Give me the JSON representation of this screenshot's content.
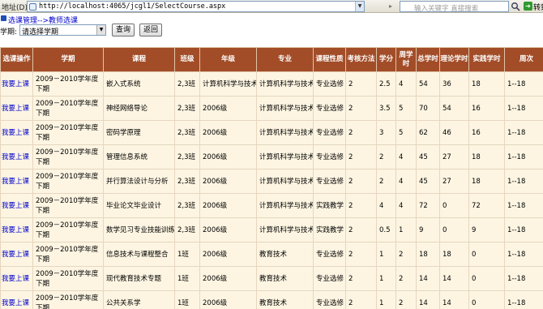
{
  "browser": {
    "address_label": "地址(D)",
    "url": "http://localhost:4065/jcgl1/SelectCourse.aspx",
    "search_placeholder": "输入关键字 直接搜索",
    "go_label": "转到"
  },
  "breadcrumb": "选课管理-->教师选课",
  "filter": {
    "label": "学期:",
    "select_value": "请选择学期",
    "query_button": "查询",
    "back_button": "返回"
  },
  "table": {
    "headers": [
      "选课操作",
      "学期",
      "课程",
      "班级",
      "年级",
      "专业",
      "课程性质",
      "考核方法",
      "学分",
      "周学时",
      "总学时",
      "理论学时",
      "实践学时",
      "周次"
    ],
    "rows": [
      [
        "我要上课",
        "2009－2010学年度下期",
        "嵌入式系统",
        "2,3班",
        "计算机科学与技术",
        "计算机科学与技术",
        "专业选修",
        "2",
        "2.5",
        "4",
        "54",
        "36",
        "18",
        "1--18"
      ],
      [
        "我要上课",
        "2009－2010学年度下期",
        "神经网络导论",
        "2,3班",
        "2006级",
        "计算机科学与技术",
        "专业选修",
        "2",
        "3.5",
        "5",
        "70",
        "54",
        "16",
        "1--18"
      ],
      [
        "我要上课",
        "2009－2010学年度下期",
        "密码学原理",
        "2,3班",
        "2006级",
        "计算机科学与技术",
        "专业选修",
        "2",
        "3",
        "5",
        "62",
        "46",
        "16",
        "1--18"
      ],
      [
        "我要上课",
        "2009－2010学年度下期",
        "管理信息系统",
        "2,3班",
        "2006级",
        "计算机科学与技术",
        "专业选修",
        "2",
        "2",
        "4",
        "45",
        "27",
        "18",
        "1--18"
      ],
      [
        "我要上课",
        "2009－2010学年度下期",
        "并行算法设计与分析",
        "2,3班",
        "2006级",
        "计算机科学与技术",
        "专业选修",
        "2",
        "2",
        "4",
        "45",
        "27",
        "18",
        "1--18"
      ],
      [
        "我要上课",
        "2009－2010学年度下期",
        "毕业论文毕业设计",
        "2,3班",
        "2006级",
        "计算机科学与技术",
        "实践教学",
        "2",
        "4",
        "4",
        "72",
        "0",
        "72",
        "1--18"
      ],
      [
        "我要上课",
        "2009－2010学年度下期",
        "数学见习专业技能训练",
        "2,3班",
        "2006级",
        "计算机科学与技术",
        "实践教学",
        "2",
        "0.5",
        "1",
        "9",
        "0",
        "9",
        "1--18"
      ],
      [
        "我要上课",
        "2009－2010学年度下期",
        "信息技术与课程整合",
        "1班",
        "2006级",
        "教育技术",
        "专业选修",
        "2",
        "1",
        "2",
        "18",
        "18",
        "0",
        "1--18"
      ],
      [
        "我要上课",
        "2009－2010学年度下期",
        "现代教育技术专题",
        "1班",
        "2006级",
        "教育技术",
        "专业选修",
        "2",
        "1",
        "2",
        "14",
        "14",
        "0",
        "1--18"
      ],
      [
        "我要上课",
        "2009－2010学年度下期",
        "公共关系学",
        "1班",
        "2006级",
        "教育技术",
        "专业选修",
        "2",
        "1",
        "2",
        "14",
        "14",
        "0",
        "1--18"
      ]
    ]
  }
}
